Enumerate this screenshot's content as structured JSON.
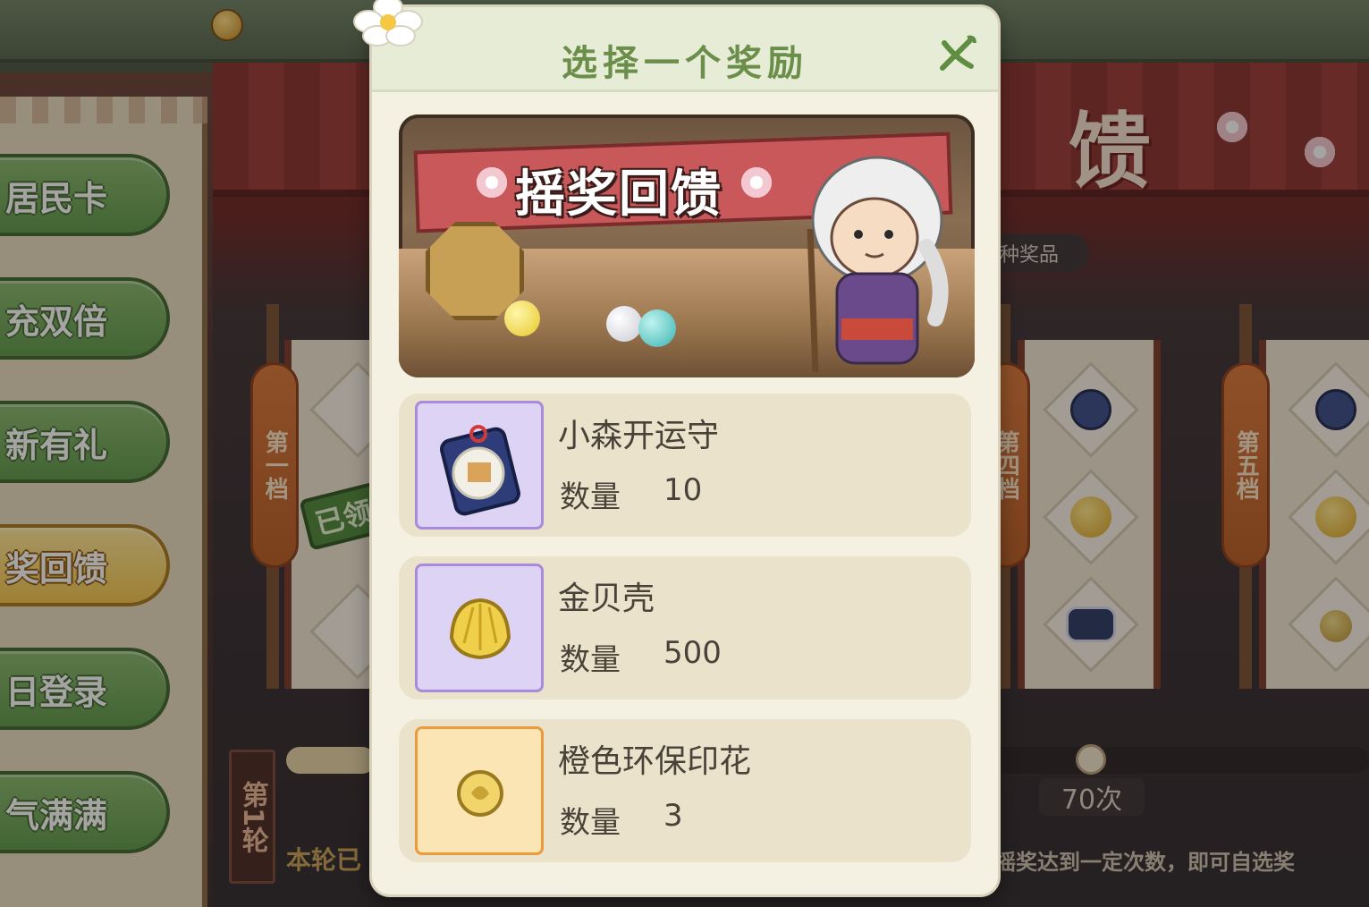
{
  "modal": {
    "title": "选择一个奖励",
    "banner_text": "摇奖回馈",
    "rewards": [
      {
        "name": "小森开运守",
        "qty_label": "数量",
        "qty": "10",
        "icon": "omamori-charm-icon",
        "rarity_color": "#a98bdc"
      },
      {
        "name": "金贝壳",
        "qty_label": "数量",
        "qty": "500",
        "icon": "gold-shell-icon",
        "rarity_color": "#a98bdc"
      },
      {
        "name": "橙色环保印花",
        "qty_label": "数量",
        "qty": "3",
        "icon": "orange-stamp-icon",
        "rarity_color": "#ec9a3c"
      }
    ]
  },
  "sidebar": {
    "items": [
      {
        "label": "居民卡"
      },
      {
        "label": "充双倍"
      },
      {
        "label": "新有礼"
      },
      {
        "label": "奖回馈"
      },
      {
        "label": "日登录"
      },
      {
        "label": "气满满"
      }
    ]
  },
  "background": {
    "banner_char": "馈",
    "prize_pill": "种奖品",
    "tiers": [
      {
        "label": "第一档"
      },
      {
        "label": "第四档"
      },
      {
        "label": "第五档"
      }
    ],
    "claimed_stamp": "已领",
    "count_pill": "70次",
    "round_tag": "第1轮",
    "round_note": "本轮已",
    "bottom_note": "摇奖达到一定次数，即可自选奖"
  },
  "colors": {
    "accent_green": "#6b8f4a",
    "modal_bg": "#f4f0e2",
    "purple_frame": "#a98bdc",
    "orange_frame": "#ec9a3c"
  }
}
